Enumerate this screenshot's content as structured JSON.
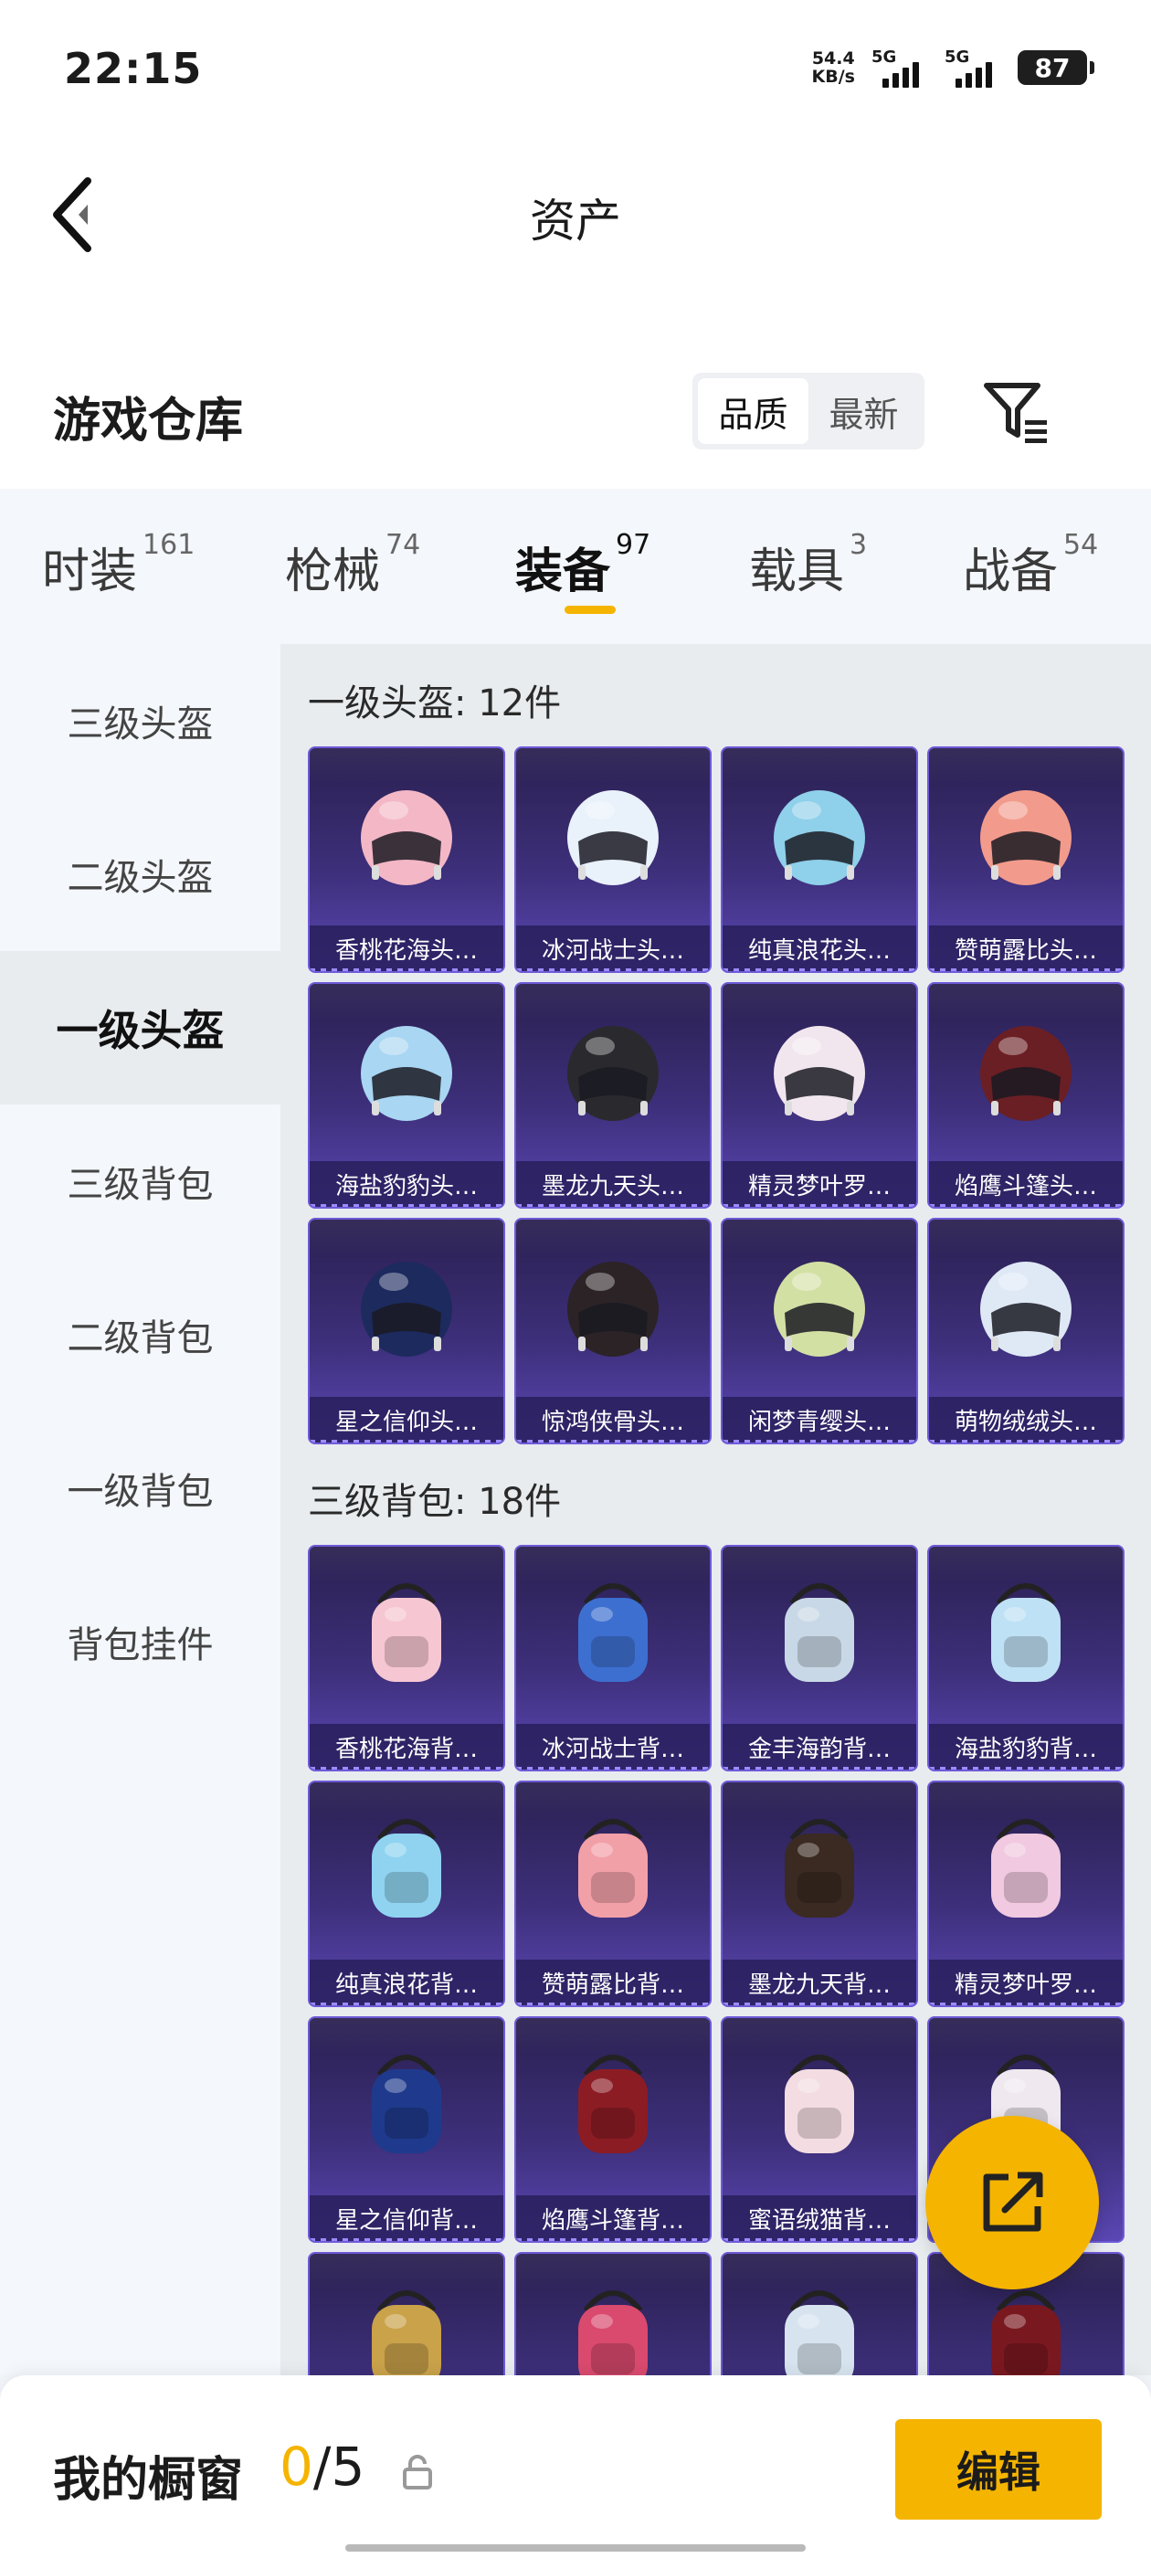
{
  "status_bar": {
    "time": "22:15",
    "net_speed": "54.4",
    "net_unit": "KB/s",
    "sim1": "5G",
    "sim2": "5G",
    "battery": "87"
  },
  "header": {
    "title": "资产"
  },
  "section": {
    "title": "游戏仓库",
    "sort_options": [
      "品质",
      "最新"
    ],
    "sort_selected": "品质"
  },
  "tabs": [
    {
      "label": "时装",
      "count": "161"
    },
    {
      "label": "枪械",
      "count": "74"
    },
    {
      "label": "装备",
      "count": "97",
      "active": true
    },
    {
      "label": "载具",
      "count": "3"
    },
    {
      "label": "战备",
      "count": "54"
    }
  ],
  "sidebar": [
    {
      "label": "三级头盔"
    },
    {
      "label": "二级头盔"
    },
    {
      "label": "一级头盔",
      "active": true
    },
    {
      "label": "三级背包"
    },
    {
      "label": "二级背包"
    },
    {
      "label": "一级背包"
    },
    {
      "label": "背包挂件"
    }
  ],
  "groups": [
    {
      "title": "一级头盔: 12件",
      "items": [
        {
          "name": "香桃花海头…",
          "icon": "helmet-icon",
          "color": "#f3b7c6"
        },
        {
          "name": "冰河战士头…",
          "icon": "helmet-icon",
          "color": "#e9f1fb"
        },
        {
          "name": "纯真浪花头…",
          "icon": "helmet-icon",
          "color": "#8fd0ea"
        },
        {
          "name": "赞萌露比头…",
          "icon": "helmet-icon",
          "color": "#f29b8c"
        },
        {
          "name": "海盐豹豹头…",
          "icon": "helmet-icon",
          "color": "#a9d6f2"
        },
        {
          "name": "墨龙九天头…",
          "icon": "helmet-icon",
          "color": "#2a2a2e"
        },
        {
          "name": "精灵梦叶罗…",
          "icon": "helmet-icon",
          "color": "#f2e6ee"
        },
        {
          "name": "焰鹰斗篷头…",
          "icon": "helmet-icon",
          "color": "#6a1f24"
        },
        {
          "name": "星之信仰头…",
          "icon": "helmet-icon",
          "color": "#1d2a5e"
        },
        {
          "name": "惊鸿侠骨头…",
          "icon": "helmet-icon",
          "color": "#2b2326"
        },
        {
          "name": "闲梦青缨头…",
          "icon": "helmet-icon",
          "color": "#d3e0a4"
        },
        {
          "name": "萌物绒绒头…",
          "icon": "helmet-icon",
          "color": "#dfe9f6"
        }
      ]
    },
    {
      "title": "三级背包: 18件",
      "items": [
        {
          "name": "香桃花海背…",
          "icon": "backpack-icon",
          "color": "#f6c6d2"
        },
        {
          "name": "冰河战士背…",
          "icon": "backpack-icon",
          "color": "#3d6fd0"
        },
        {
          "name": "金丰海韵背…",
          "icon": "backpack-icon",
          "color": "#c9d8e6"
        },
        {
          "name": "海盐豹豹背…",
          "icon": "backpack-icon",
          "color": "#bfe1f5"
        },
        {
          "name": "纯真浪花背…",
          "icon": "backpack-icon",
          "color": "#8fd3f0"
        },
        {
          "name": "赞萌露比背…",
          "icon": "backpack-icon",
          "color": "#f2a0a8"
        },
        {
          "name": "墨龙九天背…",
          "icon": "backpack-icon",
          "color": "#3a2a22"
        },
        {
          "name": "精灵梦叶罗…",
          "icon": "backpack-icon",
          "color": "#f1c9e0"
        },
        {
          "name": "星之信仰背…",
          "icon": "backpack-icon",
          "color": "#1f3a8c"
        },
        {
          "name": "焰鹰斗篷背…",
          "icon": "backpack-icon",
          "color": "#8c1c24"
        },
        {
          "name": "蜜语绒猫背…",
          "icon": "backpack-icon",
          "color": "#f3dde2"
        },
        {
          "name": "",
          "icon": "backpack-icon",
          "color": "#efe9ef"
        },
        {
          "name": "",
          "icon": "backpack-icon",
          "color": "#c9a24a"
        },
        {
          "name": "",
          "icon": "backpack-icon",
          "color": "#d94a6e"
        },
        {
          "name": "",
          "icon": "backpack-icon",
          "color": "#d7e4ef"
        },
        {
          "name": "",
          "icon": "backpack-icon",
          "color": "#7a1820"
        }
      ]
    }
  ],
  "bottom_bar": {
    "label": "我的橱窗",
    "current": "0",
    "separator": "/",
    "max": "5",
    "edit_label": "编辑"
  },
  "colors": {
    "accent": "#f5b400",
    "card_bg": "#3d2f7a",
    "card_border": "#6e5ad8"
  }
}
